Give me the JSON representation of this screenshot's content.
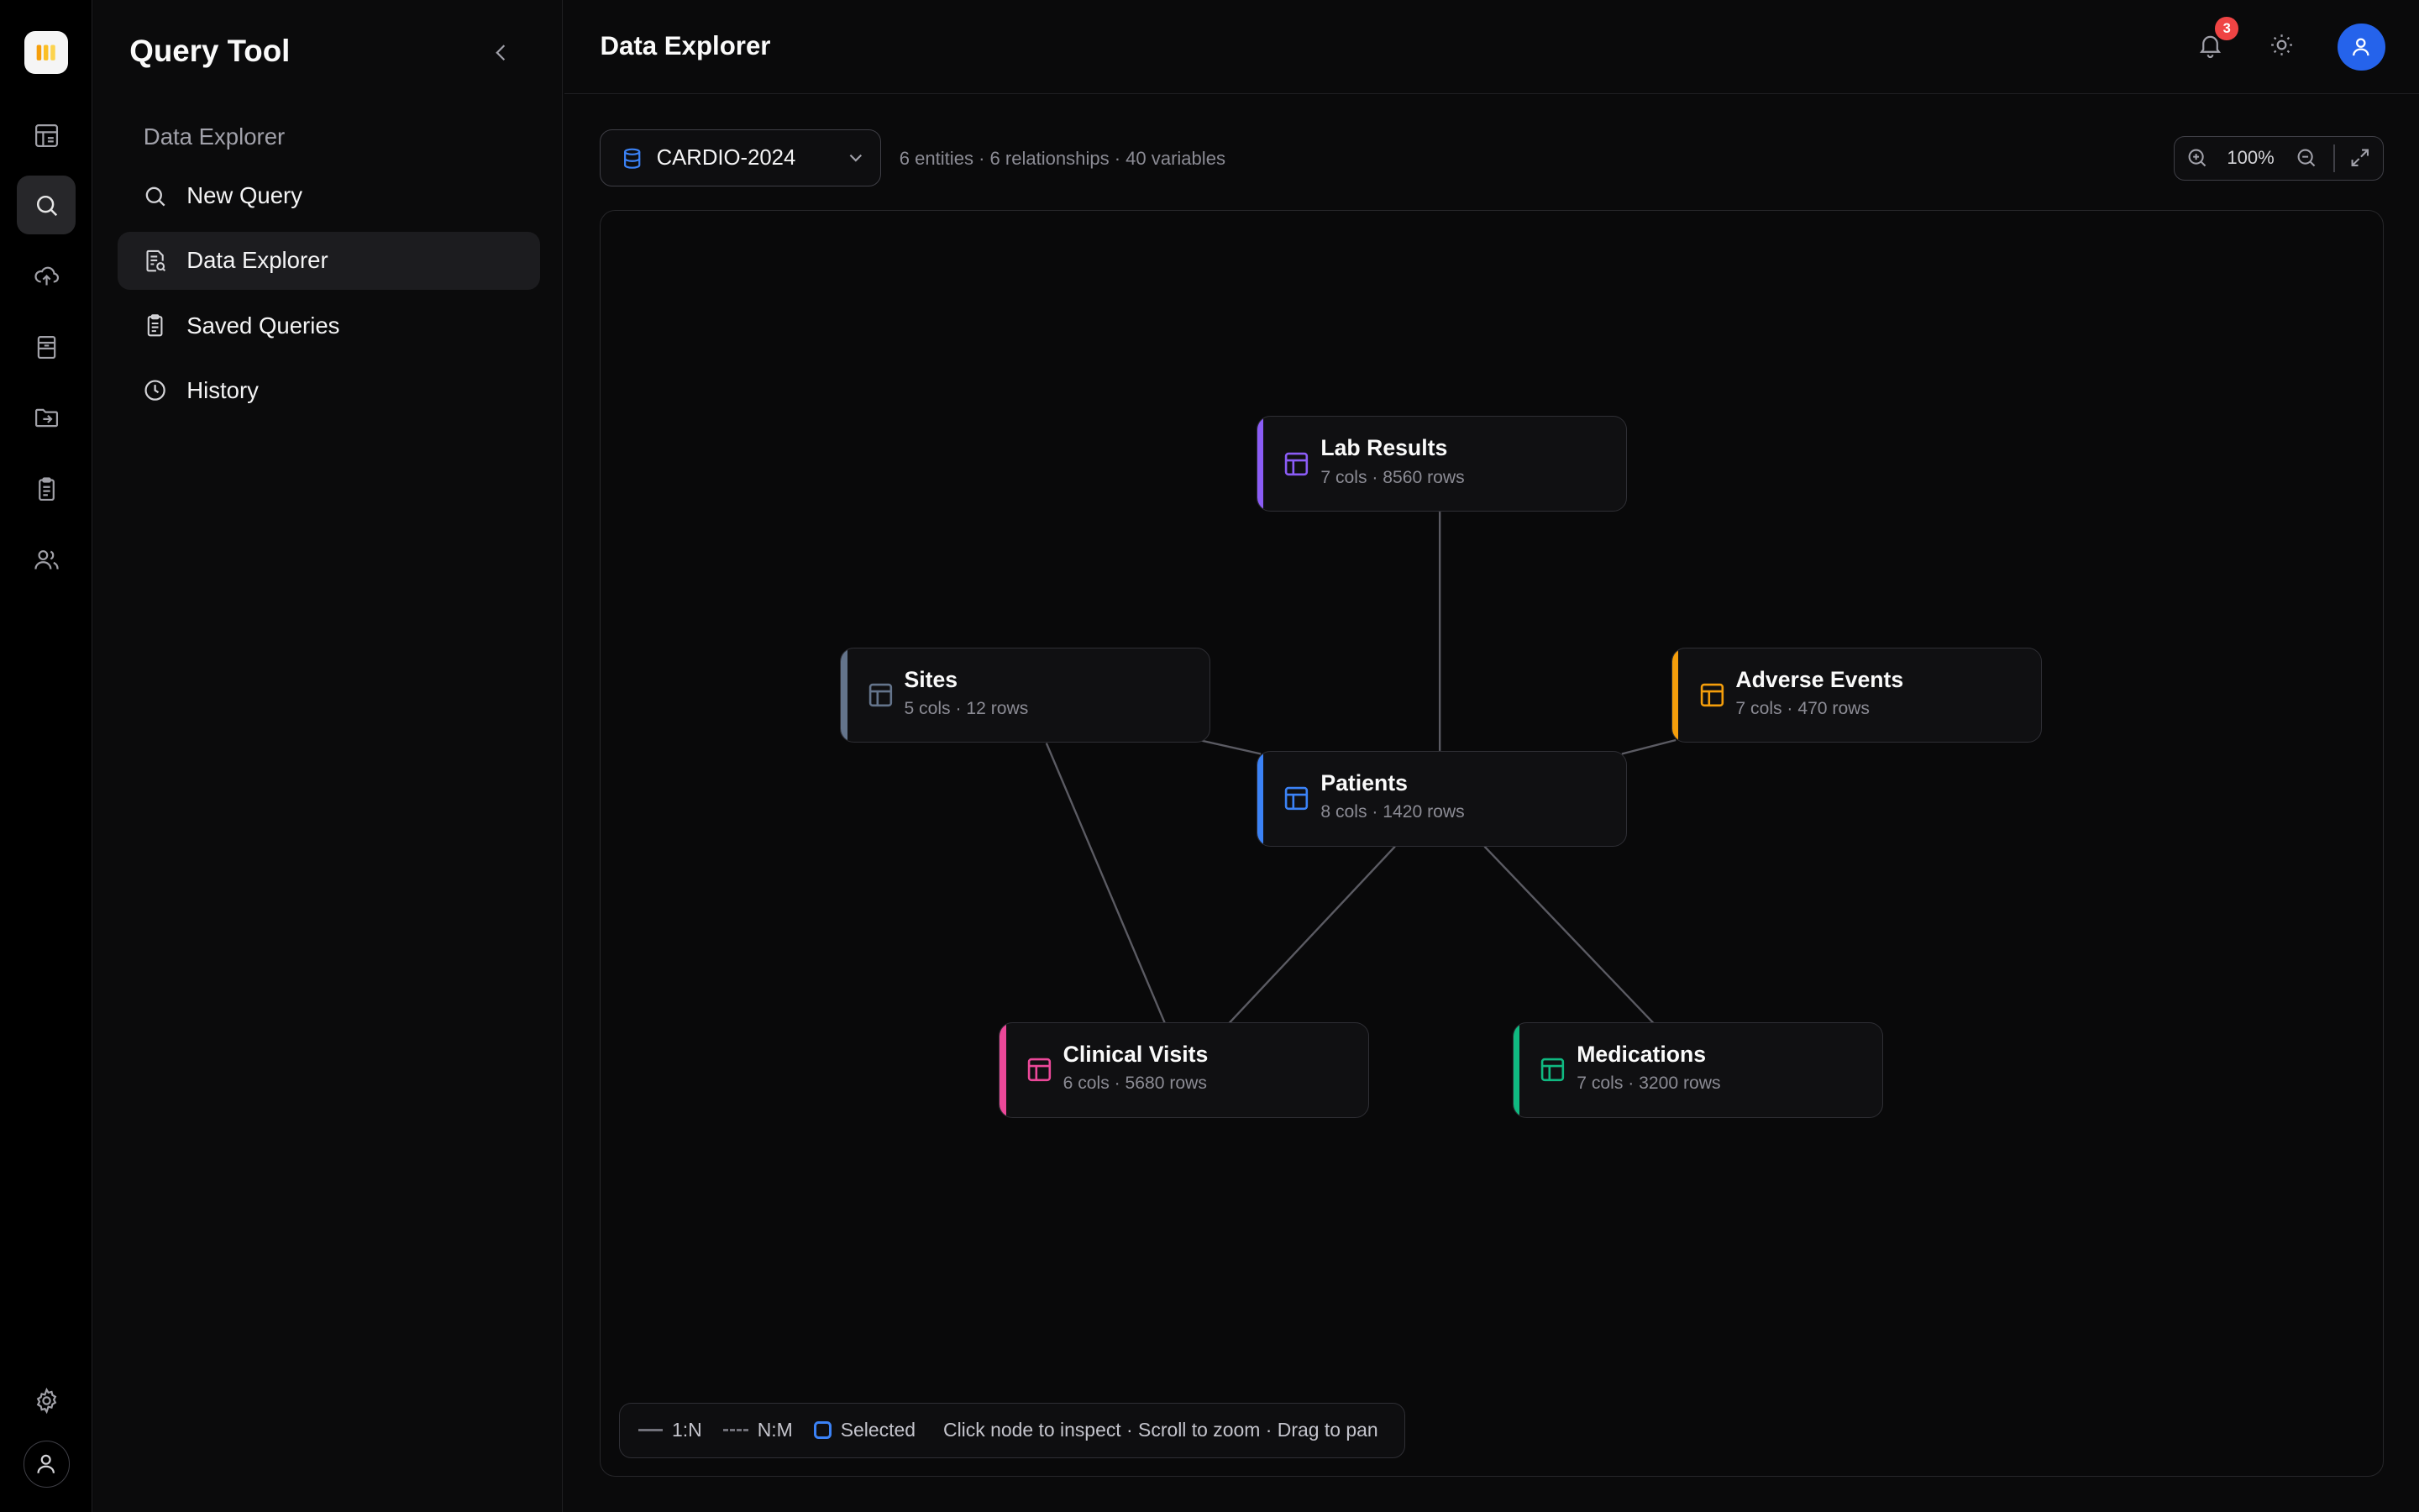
{
  "app": {
    "title": "Query Tool"
  },
  "rail": {
    "items": [
      "dashboard-icon",
      "search-icon",
      "upload-icon",
      "archive-icon",
      "folder-import-icon",
      "clipboard-icon",
      "users-icon"
    ],
    "active": "search-icon"
  },
  "sidebar": {
    "section": "Data Explorer",
    "items": [
      {
        "label": "New Query",
        "icon": "search-icon"
      },
      {
        "label": "Data Explorer",
        "icon": "data-explorer-icon",
        "active": true
      },
      {
        "label": "Saved Queries",
        "icon": "clipboard-icon"
      },
      {
        "label": "History",
        "icon": "clock-icon"
      }
    ]
  },
  "header": {
    "title": "Data Explorer",
    "notifications": "3"
  },
  "toolbar": {
    "dataset": "CARDIO-2024",
    "stats": "6 entities · 6 relationships · 40 variables",
    "zoom": "100%"
  },
  "graph": {
    "nodes": [
      {
        "id": "lab",
        "name": "Lab Results",
        "meta": "7 cols · 8560 rows",
        "color": "#8b5cf6"
      },
      {
        "id": "sites",
        "name": "Sites",
        "meta": "5 cols · 12 rows",
        "color": "#64748b"
      },
      {
        "id": "adverse",
        "name": "Adverse Events",
        "meta": "7 cols · 470 rows",
        "color": "#f59e0b"
      },
      {
        "id": "patients",
        "name": "Patients",
        "meta": "8 cols · 1420 rows",
        "color": "#3b82f6"
      },
      {
        "id": "visits",
        "name": "Clinical Visits",
        "meta": "6 cols · 5680 rows",
        "color": "#ec4899"
      },
      {
        "id": "meds",
        "name": "Medications",
        "meta": "7 cols · 3200 rows",
        "color": "#10b981"
      }
    ],
    "edges": [
      {
        "from": "lab",
        "to": "patients",
        "type": "1:N"
      },
      {
        "from": "sites",
        "to": "patients",
        "type": "1:N"
      },
      {
        "from": "adverse",
        "to": "patients",
        "type": "1:N"
      },
      {
        "from": "patients",
        "to": "visits",
        "type": "1:N"
      },
      {
        "from": "patients",
        "to": "meds",
        "type": "1:N"
      },
      {
        "from": "sites",
        "to": "visits",
        "type": "1:N"
      }
    ]
  },
  "legend": {
    "one_to_many": "1:N",
    "many_to_many": "N:M",
    "selected": "Selected",
    "hint": "Click node to inspect · Scroll to zoom · Drag to pan"
  }
}
